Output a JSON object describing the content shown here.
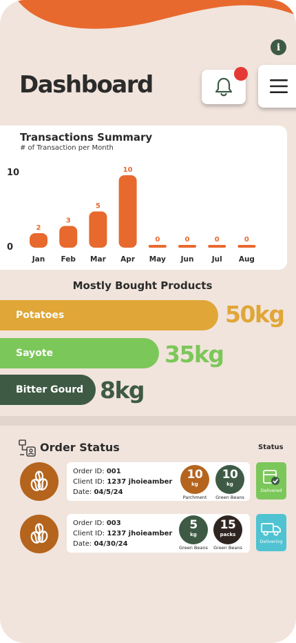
{
  "header": {
    "title": "Dashboard"
  },
  "transactions": {
    "title": "Transactions Summary",
    "subtitle": "# of Transaction per Month"
  },
  "chart_data": {
    "type": "bar",
    "categories": [
      "Jan",
      "Feb",
      "Mar",
      "Apr",
      "May",
      "Jun",
      "Jul",
      "Aug"
    ],
    "values": [
      2,
      3,
      5,
      10,
      0,
      0,
      0,
      0
    ],
    "y_ticks": [
      "10",
      "0"
    ],
    "ylim": [
      0,
      10
    ],
    "color": "#e8692e",
    "label_color": "#e8692e"
  },
  "products": {
    "title": "Mostly Bought Products",
    "items": [
      {
        "name": "Potatoes",
        "amount": "50kg",
        "color": "#e0a638"
      },
      {
        "name": "Sayote",
        "amount": "35kg",
        "color": "#7cc75a"
      },
      {
        "name": "Bitter Gourd",
        "amount": "8kg",
        "color": "#3e5a45"
      }
    ]
  },
  "orders": {
    "title": "Order Status",
    "status_header": "Status",
    "items": [
      {
        "order_label": "Order ID:",
        "order_id": "001",
        "client_label": "Client ID:",
        "client_id": "1237 jhoieamber",
        "date_label": "Date:",
        "date": "04/5/24",
        "q1_value": "10",
        "q1_unit": "kg",
        "q1_caption": "Parchment",
        "q2_value": "10",
        "q2_unit": "kg",
        "q2_caption": "Green Beans",
        "status": "Delivered"
      },
      {
        "order_label": "Order ID:",
        "order_id": "003",
        "client_label": "Client ID:",
        "client_id": "1237 jhoieamber",
        "date_label": "Date:",
        "date": "04/30/24",
        "q1_value": "5",
        "q1_unit": "kg",
        "q1_caption": "Green Beans",
        "q2_value": "15",
        "q2_unit": "packs",
        "q2_caption": "Green Beans",
        "status": "Delivering"
      }
    ]
  },
  "colors": {
    "accent": "#e8692e",
    "background": "#f1e4dc",
    "coffee": "#b4641d",
    "dark_green": "#3e5a45",
    "delivered": "#7cc75a",
    "delivering": "#4fc3d2"
  }
}
